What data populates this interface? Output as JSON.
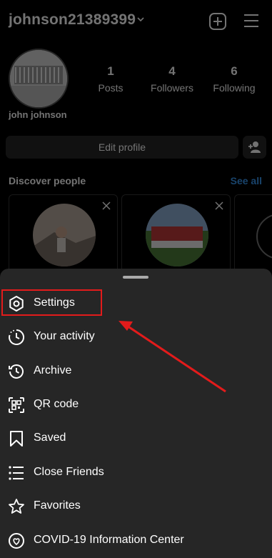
{
  "header": {
    "username": "johnson21389399"
  },
  "profile": {
    "display_name": "john johnson",
    "stats": [
      {
        "value": "1",
        "label": "Posts"
      },
      {
        "value": "4",
        "label": "Followers"
      },
      {
        "value": "6",
        "label": "Following"
      }
    ],
    "edit_label": "Edit profile"
  },
  "discover": {
    "title": "Discover people",
    "see_all": "See all"
  },
  "menu": {
    "items": [
      {
        "label": "Settings",
        "icon": "settings-icon"
      },
      {
        "label": "Your activity",
        "icon": "activity-icon"
      },
      {
        "label": "Archive",
        "icon": "archive-icon"
      },
      {
        "label": "QR code",
        "icon": "qr-code-icon"
      },
      {
        "label": "Saved",
        "icon": "bookmark-icon"
      },
      {
        "label": "Close Friends",
        "icon": "close-friends-icon"
      },
      {
        "label": "Favorites",
        "icon": "star-icon"
      },
      {
        "label": "COVID-19 Information Center",
        "icon": "covid-info-icon"
      }
    ]
  },
  "colors": {
    "highlight": "#e31b1b",
    "link": "#3897f0",
    "sheet": "#262626"
  }
}
